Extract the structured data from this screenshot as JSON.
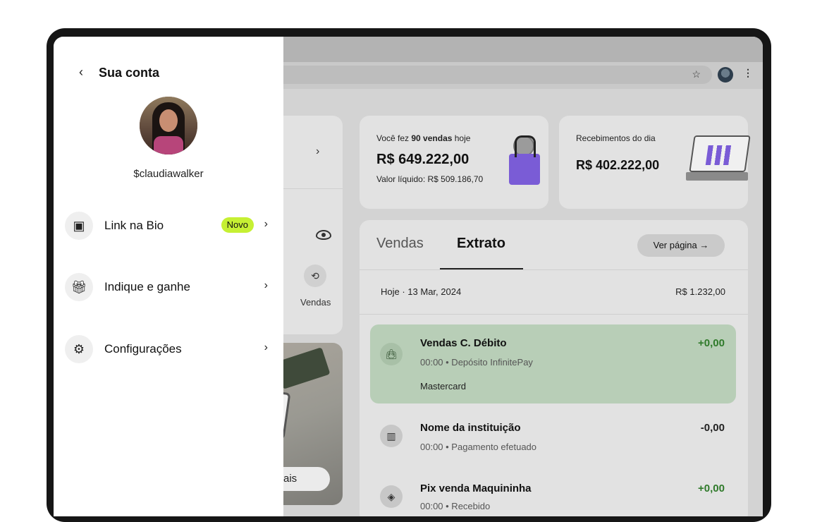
{
  "panel": {
    "title": "Sua conta",
    "username": "$claudiawalker",
    "menu": [
      {
        "label": "Link na Bio",
        "icon": "browser-link-icon",
        "badge": "Novo"
      },
      {
        "label": "Indique e ganhe",
        "icon": "gift-icon"
      },
      {
        "label": "Configurações",
        "icon": "gear-icon"
      }
    ]
  },
  "left_column": {
    "vendas_label": "Vendas",
    "promo_button": "er mais"
  },
  "sales_card": {
    "prefix": "Você fez ",
    "count_text": "90 vendas",
    "suffix": " hoje",
    "amount": "R$ 649.222,00",
    "net_value": "Valor líquido: R$ 509.186,70"
  },
  "receipts_card": {
    "title": "Recebimentos do dia",
    "amount": "R$ 402.222,00"
  },
  "statement": {
    "tabs": [
      "Vendas",
      "Extrato"
    ],
    "active_tab": "Extrato",
    "view_page_label": "Ver página →",
    "day": {
      "date": "Hoje · 13 Mar, 2024",
      "total": "R$ 1.232,00"
    },
    "transactions": [
      {
        "title": "Vendas C. Débito",
        "subtitle": "00:00 • Depósito InfinitePay",
        "extra": "Mastercard",
        "amount": "+0,00",
        "icon": "shopping-bag-icon"
      },
      {
        "title": "Nome da instituição",
        "subtitle": "00:00 • Pagamento efetuado",
        "amount": "-0,00",
        "icon": "barcode-icon"
      },
      {
        "title": "Pix venda Maquininha",
        "subtitle": "00:00 • Recebido",
        "amount": "+0,00",
        "icon": "pix-icon"
      }
    ]
  },
  "colors": {
    "badge": "#c6f033",
    "highlight_row": "#b8ceb7",
    "positive_amount": "#2f7a2a"
  }
}
